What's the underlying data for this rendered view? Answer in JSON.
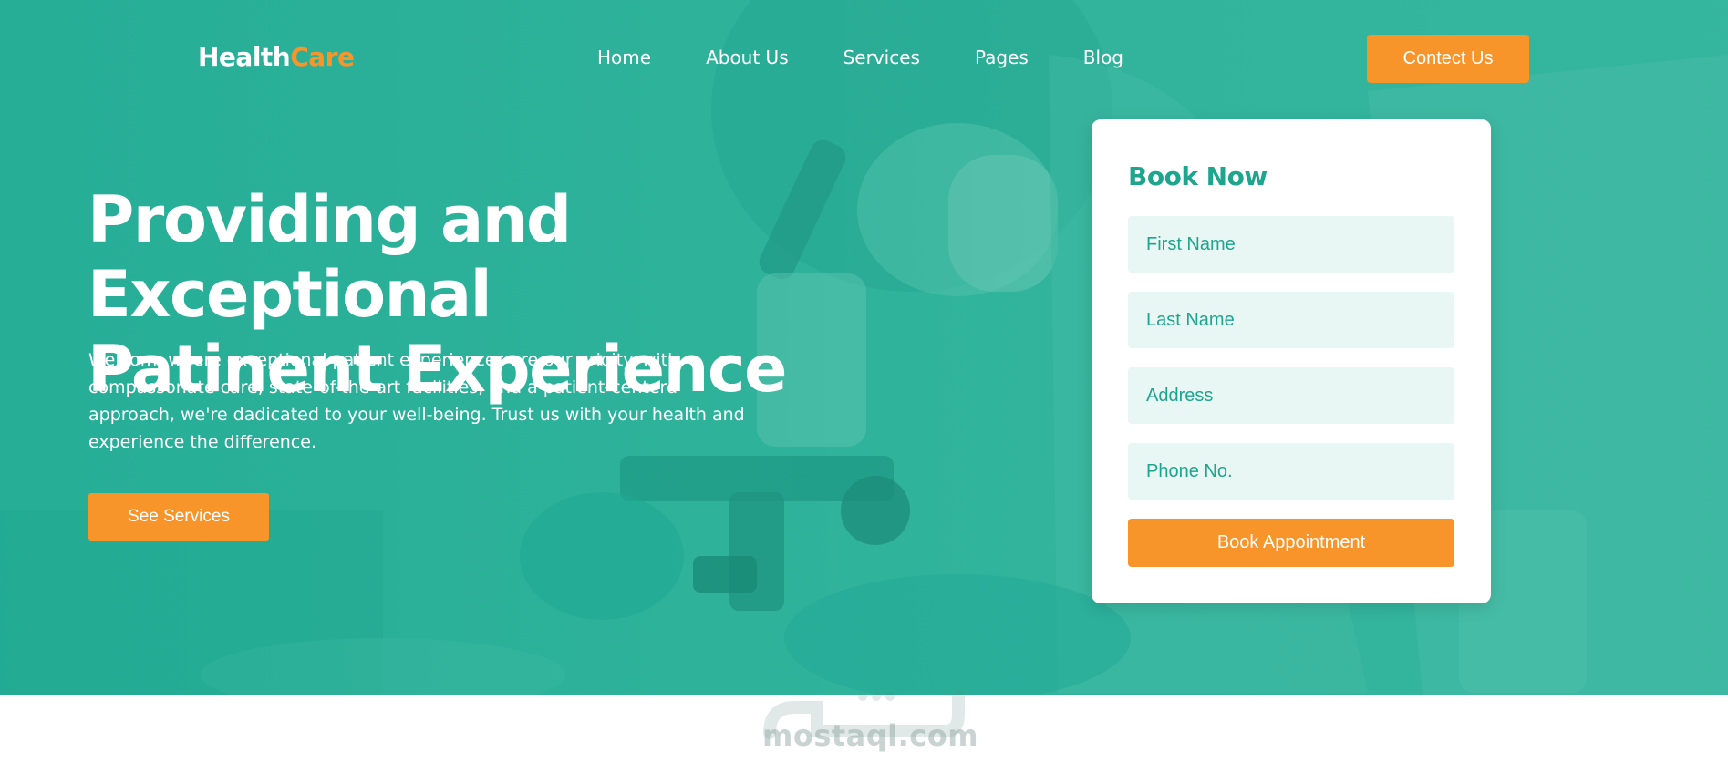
{
  "brand": {
    "name_part1": "Health",
    "name_part2": "Care"
  },
  "nav": {
    "items": [
      "Home",
      "About Us",
      "Services",
      "Pages",
      "Blog"
    ],
    "contact_label": "Contect Us"
  },
  "hero": {
    "headline_line1": "Providing and Exceptional",
    "headline_line2": "Patinent Experience",
    "intro": "Welcom, where exceptional patient experiences are our prioity. with compassonate care, state-of-the-art facilities, and a patient-centerd approach, we're dadicated to your well-being. Trust us with your health and experience the difference.",
    "cta_label": "See Services"
  },
  "booking": {
    "title": "Book Now",
    "fields": {
      "first_name": "First Name",
      "last_name": "Last Name",
      "address": "Address",
      "phone": "Phone No."
    },
    "submit_label": "Book Appointment"
  },
  "watermark": {
    "text": "mostaql.com"
  },
  "colors": {
    "primary": "#1ea58d",
    "accent": "#f7942a",
    "hero_overlay": "#2fb39b",
    "field_bg": "#e8f6f4"
  }
}
